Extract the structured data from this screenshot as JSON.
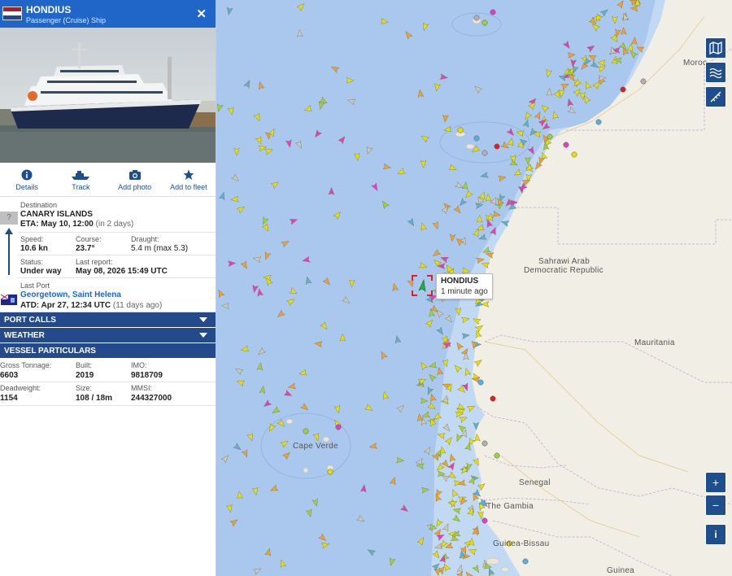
{
  "vessel": {
    "name": "HONDIUS",
    "type": "Passenger (Cruise) Ship",
    "flag_colors": [
      "#ae1c28",
      "#ffffff",
      "#21468b"
    ]
  },
  "actions": [
    {
      "label": "Details",
      "icon": "info-icon"
    },
    {
      "label": "Track",
      "icon": "ship-icon"
    },
    {
      "label": "Add photo",
      "icon": "camera-icon"
    },
    {
      "label": "Add to fleet",
      "icon": "star-icon"
    }
  ],
  "voyage": {
    "destination_label": "Destination",
    "destination": "CANARY ISLANDS",
    "eta": "ETA: May 10, 12:00",
    "eta_note": "(in 2 days)",
    "unknown_port_icon": "?",
    "speed_label": "Speed:",
    "speed": "10.6 kn",
    "course_label": "Course:",
    "course": "23.7°",
    "draught_label": "Draught:",
    "draught": "5.4 m (max 5.3)",
    "status_label": "Status:",
    "status": "Under way",
    "last_report_label": "Last report:",
    "last_report": "May 08, 2026 15:49 UTC",
    "last_port_label": "Last Port",
    "last_port_city": "Georgetown,",
    "last_port_country": "Saint Helena",
    "atd": "ATD: Apr 27, 12:34 UTC",
    "atd_note": "(11 days ago)"
  },
  "sections": {
    "port_calls": "PORT CALLS",
    "weather": "WEATHER",
    "particulars": "VESSEL PARTICULARS"
  },
  "particulars": {
    "gross_tonnage_label": "Gross Tonnage:",
    "gross_tonnage": "6603",
    "built_label": "Built:",
    "built": "2019",
    "imo_label": "IMO:",
    "imo": "9818709",
    "deadweight_label": "Deadweight:",
    "deadweight": "1154",
    "size_label": "Size:",
    "size": "108 / 18m",
    "mmsi_label": "MMSI:",
    "mmsi": "244327000"
  },
  "map": {
    "tooltip_name": "HONDIUS",
    "tooltip_time": "1 minute ago",
    "labels": {
      "moroc": "Moroc",
      "sahrawi1": "Sahrawi Arab",
      "sahrawi2": "Democratic Republic",
      "mauritania": "Mauritania",
      "cape_verde": "Cape Verde",
      "senegal": "Senegal",
      "gambia": "The Gambia",
      "guinea_bissau": "Guinea-Bissau",
      "guinea": "Guinea"
    },
    "controls": {
      "zoom_in": "+",
      "zoom_out": "−",
      "info": "i"
    },
    "colors": {
      "sea": "#aac8ee",
      "land": "#f1eee6",
      "accent": "#1f4e8c",
      "header": "#1f66c8"
    }
  }
}
